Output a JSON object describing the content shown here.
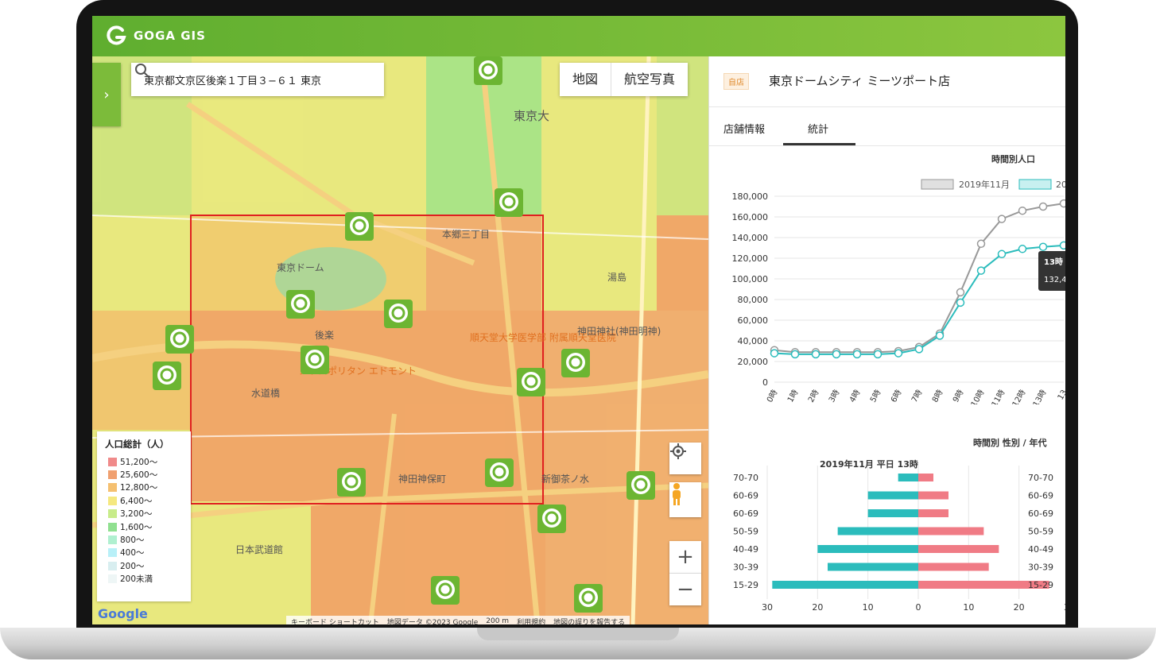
{
  "app": {
    "name": "GOGA GIS"
  },
  "search": {
    "value": "東京都文京区後楽１丁目３−６１ 東京",
    "placeholder": ""
  },
  "map_type": {
    "map_label": "地図",
    "satellite_label": "航空写真"
  },
  "legend": {
    "title": "人口総計（人）",
    "items": [
      {
        "label": "51,200〜",
        "color": "#f08a8a"
      },
      {
        "label": "25,600〜",
        "color": "#f0a070"
      },
      {
        "label": "12,800〜",
        "color": "#f5c070"
      },
      {
        "label": "6,400〜",
        "color": "#f5e880"
      },
      {
        "label": "3,200〜",
        "color": "#c8ec8a"
      },
      {
        "label": "1,600〜",
        "color": "#90e090"
      },
      {
        "label": "800〜",
        "color": "#b0f0d0"
      },
      {
        "label": "400〜",
        "color": "#b8f0f8"
      },
      {
        "label": "200〜",
        "color": "#d8eef0"
      },
      {
        "label": "200未満",
        "color": "#eef6f6"
      }
    ]
  },
  "map_labels": {
    "tokyo_dome": "東京ドーム",
    "korakuen": "後楽",
    "kanda_jinbocho": "神田神保町",
    "tokyo_univ": "東京大",
    "yushima": "湯島",
    "ochanomizu": "新御茶ノ水",
    "juntendo": "順天堂大学医学部\n附属順天堂医院",
    "metropolitan": "メトロポリタン\nエドモント",
    "nihon_budokan": "日本武道館",
    "kandamyojin": "神田神社(神田明神)",
    "hongo": "本郷三丁目",
    "suidobashi": "水道橋"
  },
  "attribution": {
    "google": "Google",
    "keyboard": "キーボード ショートカット",
    "mapdata": "地図データ ©2023 Google",
    "scale": "200 m",
    "terms": "利用規約",
    "report": "地図の誤りを報告する"
  },
  "panel": {
    "store_badge": "自店",
    "store_name": "東京ドームシティ ミーツポート店",
    "tabs": [
      {
        "label": "店舗情報"
      },
      {
        "label": "統計"
      }
    ],
    "active_tab": "統計"
  },
  "colors": {
    "header": "#6cb532",
    "primary": "#7cbb3a",
    "series1": "#999999",
    "series2": "#2bbcbc",
    "male": "#2bbcbc",
    "female": "#f07b85",
    "selection": "#e02020"
  },
  "chart_data": [
    {
      "type": "line",
      "title": "時間別人口",
      "series": [
        {
          "name": "2019年11月",
          "values": [
            31000,
            29000,
            29000,
            29000,
            29000,
            29000,
            30000,
            34000,
            47000,
            87000,
            134000,
            158000,
            166000,
            170000,
            173000
          ]
        },
        {
          "name": "20",
          "values": [
            28000,
            27000,
            27000,
            27000,
            27000,
            27000,
            28000,
            32000,
            45000,
            77000,
            108000,
            124000,
            129000,
            131000,
            132400
          ]
        }
      ],
      "x": [
        "0時",
        "1時",
        "2時",
        "3時",
        "4時",
        "5時",
        "6時",
        "7時",
        "8時",
        "9時",
        "10時",
        "11時",
        "12時",
        "13時",
        "13"
      ],
      "ylim": [
        0,
        180000
      ],
      "yticks": [
        "180,000",
        "160,000",
        "140,000",
        "120,000",
        "100,000",
        "80,000",
        "60,000",
        "40,000",
        "20,000",
        "0"
      ],
      "tooltip": {
        "title": "13時",
        "value": "132,4"
      },
      "grid": true,
      "legend_position": "top-right"
    },
    {
      "type": "bar",
      "title": "時間別 性別 / 年代",
      "subtitle": "2019年11月 平日 13時",
      "categories": [
        "70-70",
        "60-69",
        "60-69",
        "50-59",
        "40-49",
        "30-39",
        "15-29"
      ],
      "series": [
        {
          "name": "male",
          "values": [
            4,
            10,
            10,
            16,
            20,
            18,
            29
          ]
        },
        {
          "name": "female",
          "values": [
            3,
            6,
            6,
            13,
            16,
            14,
            26
          ]
        }
      ],
      "xticks": [
        "30",
        "20",
        "10",
        "0",
        "10",
        "20",
        "30"
      ],
      "xlim": [
        -30,
        30
      ],
      "grid": true
    }
  ]
}
